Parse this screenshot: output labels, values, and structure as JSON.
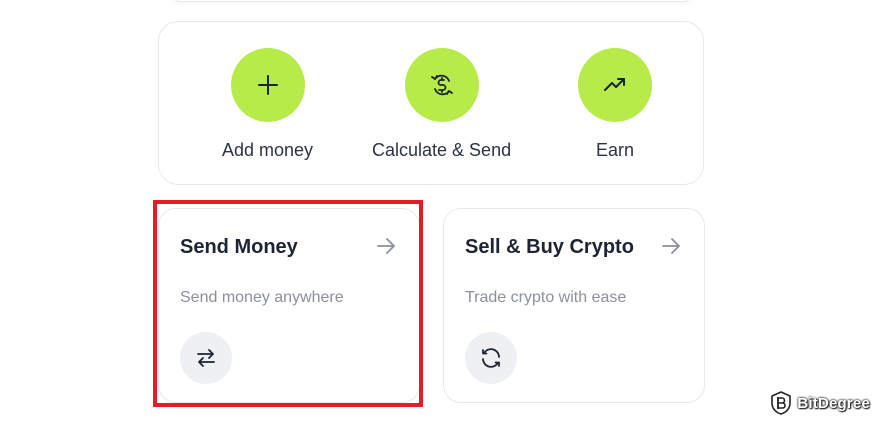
{
  "actions": [
    {
      "label": "Add money",
      "icon": "plus-icon"
    },
    {
      "label": "Calculate & Send",
      "icon": "calculate-send-icon"
    },
    {
      "label": "Earn",
      "icon": "trend-up-icon"
    }
  ],
  "cards": [
    {
      "title": "Send Money",
      "subtitle": "Send money anywhere",
      "icon": "swap-arrows-icon",
      "arrow_icon": "arrow-right-icon"
    },
    {
      "title": "Sell & Buy Crypto",
      "subtitle": "Trade crypto with ease",
      "icon": "refresh-icon",
      "arrow_icon": "arrow-right-icon"
    }
  ],
  "highlight": {
    "target": "Send Money",
    "color": "#e21d25"
  },
  "watermark": {
    "text": "BitDegree",
    "icon": "bitdegree-logo-icon"
  },
  "colors": {
    "accent": "#b7eb4a",
    "icon_badge_bg": "#eef0f3",
    "title_text": "#1d2433",
    "subtitle_text": "#8a909c"
  }
}
